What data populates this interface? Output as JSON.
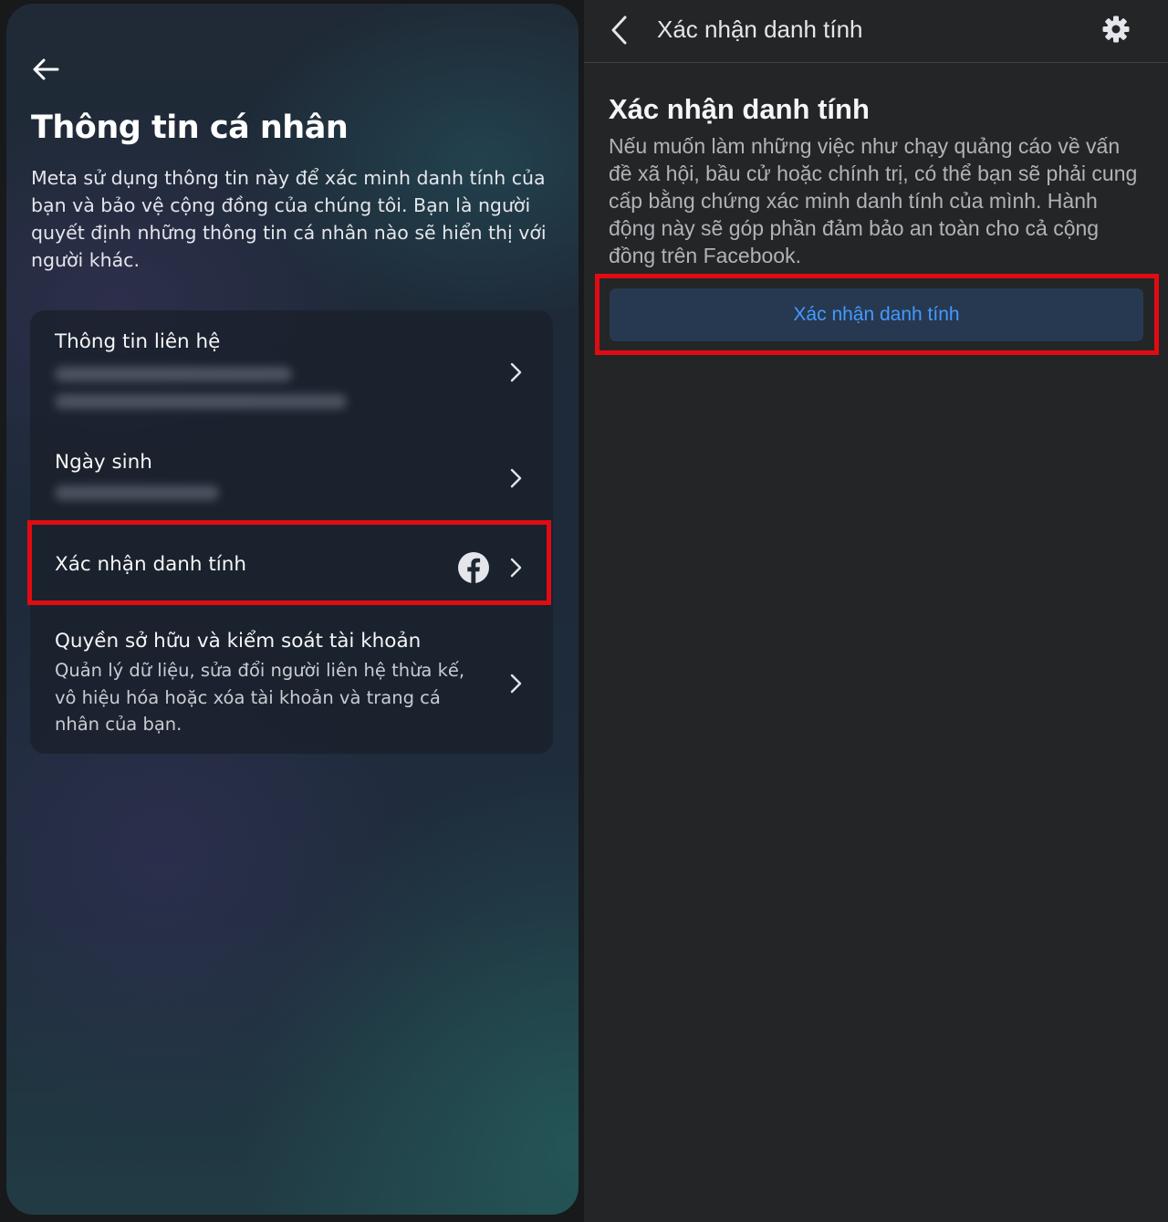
{
  "left_panel": {
    "title": "Thông tin cá nhân",
    "description": "Meta sử dụng thông tin này để xác minh danh tính của bạn và bảo vệ cộng đồng của chúng tôi. Bạn là người quyết định những thông tin cá nhân nào sẽ hiển thị với người khác.",
    "items": [
      {
        "title": "Thông tin liên hệ",
        "subtitle": "",
        "redacted": true
      },
      {
        "title": "Ngày sinh",
        "subtitle": "",
        "redacted": true
      },
      {
        "title": "Xác nhận danh tính",
        "subtitle": "",
        "icon": "facebook-icon",
        "highlighted": true
      },
      {
        "title": "Quyền sở hữu và kiểm soát tài khoản",
        "subtitle": "Quản lý dữ liệu, sửa đổi người liên hệ thừa kế, vô hiệu hóa hoặc xóa tài khoản và trang cá nhân của bạn."
      }
    ]
  },
  "right_panel": {
    "topbar_title": "Xác nhận danh tính",
    "heading": "Xác nhận danh tính",
    "description": "Nếu muốn làm những việc như chạy quảng cáo về vấn đề xã hội, bầu cử hoặc chính trị, có thể bạn sẽ phải cung cấp bằng chứng xác minh danh tính của mình. Hành động này sẽ góp phần đảm bảo an toàn cho cả cộng đồng trên Facebook.",
    "button_label": "Xác nhận danh tính"
  },
  "colors": {
    "highlight": "#e10b13",
    "link_blue": "#4599ff",
    "button_bg": "#263951",
    "right_bg": "#242526"
  }
}
